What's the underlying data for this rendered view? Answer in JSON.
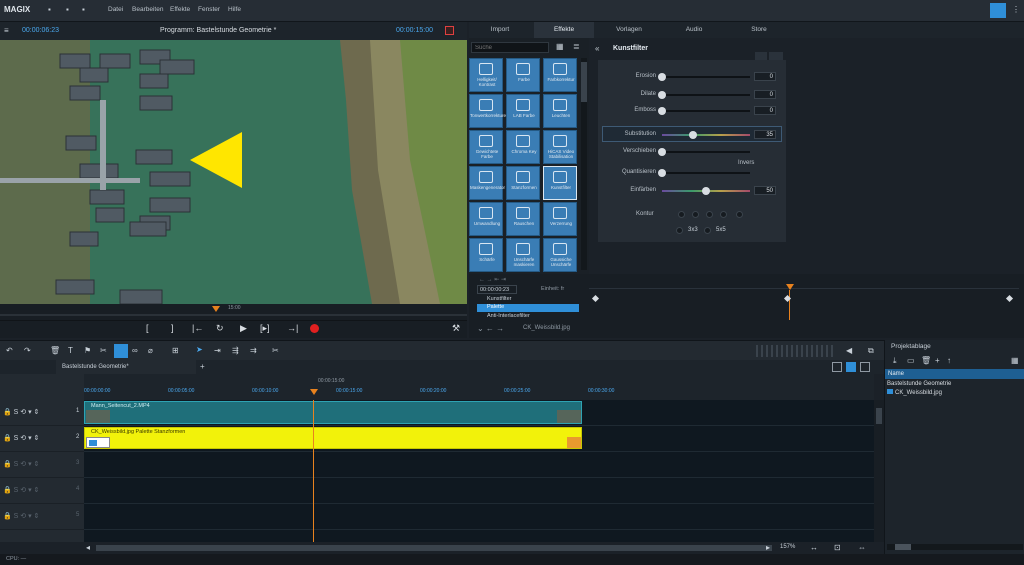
{
  "app": {
    "logo": "MAGIX",
    "menu": [
      "Datei",
      "Bearbeiten",
      "Effekte",
      "Fenster",
      "Hilfe"
    ]
  },
  "preview": {
    "timecode_left": "00:00:06:23",
    "title": "Programm: Bastelstunde Geometrie *",
    "timecode_right": "00:00:15:00",
    "playhead_time": "15:00"
  },
  "tabs": [
    "Import",
    "Effekte",
    "Vorlagen",
    "Audio",
    "Store"
  ],
  "effects": {
    "search_placeholder": "Suche",
    "tiles": [
      "Helligkeit/ Kontrast",
      "Farbe",
      "Farbkorrektur",
      "Tonwertkorrekturen",
      "LAB Farbe",
      "Leuchten",
      "Gewichtete Farbe",
      "Chroma Key",
      "HiCAS Video Stabilisation",
      "Maskengenerator",
      "Stanzformen",
      "Kunstfilter",
      "Umwandlung",
      "Rauschen",
      "Verzerrung",
      "Schärfe",
      "Unschärfe maskieren",
      "Gaussiche Unschärfe"
    ]
  },
  "filter": {
    "title": "Kunstfilter",
    "params": [
      {
        "label": "Erosion",
        "value": "0",
        "pos": 0
      },
      {
        "label": "Dilate",
        "value": "0",
        "pos": 0
      },
      {
        "label": "Emboss",
        "value": "0",
        "pos": 0
      },
      {
        "label": "Substitution",
        "value": "35",
        "pos": 0.35
      },
      {
        "label": "Verschieben",
        "value": "",
        "pos": 0
      },
      {
        "label": "Quantisieren",
        "value": "",
        "pos": 0
      },
      {
        "label": "Einfärben",
        "value": "50",
        "pos": 0.5
      }
    ],
    "invers_label": "Invers",
    "kontur_label": "Kontur",
    "kontur_opt1": "3x3",
    "kontur_opt2": "5x5"
  },
  "keyframes": {
    "time": "00:00:00:23",
    "unit_label": "Einheit: fr",
    "rows": [
      "Kunstfilter",
      "Palette",
      "Anti-Interlacefilter"
    ],
    "object": "CK_Weissbild.jpg"
  },
  "timeline": {
    "tab": "Bastelstunde Geometrie*",
    "ruler_center": "00:00:15:00",
    "ticks": [
      "00:00:00:00",
      "00:00:05:00",
      "00:00:10:00",
      "00:00:15:00",
      "00:00:20:00",
      "00:00:25:00",
      "00:00:30:00"
    ],
    "clip1": "Mann_Seitencut_2.MP4",
    "clip2": "CK_Weissbild.jpg  Palette  Stanzformen",
    "track_nums": [
      "1",
      "2",
      "3",
      "4",
      "5"
    ],
    "zoom": "157%"
  },
  "project": {
    "title": "Projektablage",
    "col_header": "Name",
    "items": [
      "Bastelstunde Geometrie",
      "CK_Weissbild.jpg"
    ]
  },
  "status": {
    "cpu": "CPU: —"
  },
  "colors": {
    "accent": "#2f8fd8",
    "clip_video": "#1f6f7a",
    "clip_yellow": "#f2f20a",
    "playhead": "#e8821e"
  }
}
